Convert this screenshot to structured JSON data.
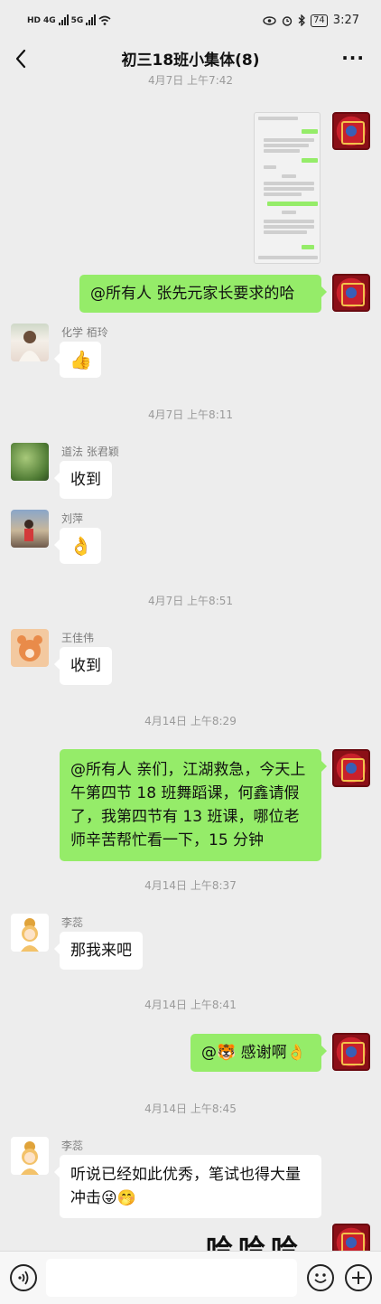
{
  "status": {
    "time": "3:27",
    "battery": "74",
    "network_left": [
      "HD",
      "4G",
      "5G"
    ]
  },
  "nav": {
    "title": "初三18班小集体(8)",
    "more": "···"
  },
  "timestamps": {
    "t0": "4月7日 上午7:42",
    "t1": "4月7日 上午8:11",
    "t2": "4月7日 上午8:51",
    "t3": "4月14日 上午8:29",
    "t4": "4月14日 上午8:37",
    "t5": "4月14日 上午8:41",
    "t6": "4月14日 上午8:45"
  },
  "messages": {
    "m1_text": "@所有人  张先元家长要求的哈",
    "m2_sender": "化学 栢玲",
    "m2_emoji": "👍",
    "m3_sender": "道法 张君颖",
    "m3_text": "收到",
    "m4_sender": "刘萍",
    "m4_emoji": "👌",
    "m5_sender": "王佳伟",
    "m5_text": "收到",
    "m6_text": "@所有人  亲们，江湖救急，今天上午第四节 18 班舞蹈课，何鑫请假了，我第四节有 13 班课，哪位老师辛苦帮忙看一下，15 分钟",
    "m7_sender": "李蕊",
    "m7_text": "那我来吧",
    "m8_at": "@",
    "m8_icon": "🐯",
    "m8_text": " 感谢啊",
    "m8_emoji": "👌",
    "m9_sender": "李蕊",
    "m9_text": "听说已经如此优秀，笔试也得大量冲击",
    "m9_emojis": "😜🤭",
    "m10_sticker": "哈哈哈"
  },
  "icons": {
    "back": "back-arrow-icon",
    "voice": "voice-icon",
    "emoji": "emoji-icon",
    "plus": "plus-icon"
  },
  "colors": {
    "background": "#ededed",
    "outgoing_bubble": "#95ec69",
    "incoming_bubble": "#ffffff",
    "timestamp": "#9a9a9a"
  }
}
